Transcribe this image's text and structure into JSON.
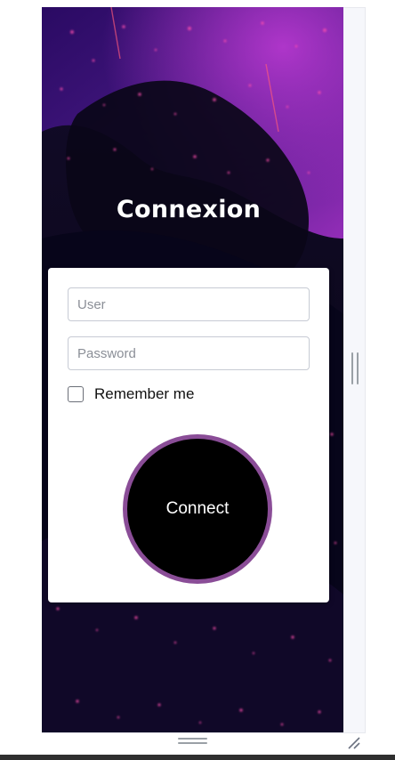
{
  "page": {
    "title": "Connexion"
  },
  "form": {
    "user_placeholder": "User",
    "password_placeholder": "Password",
    "remember_label": "Remember me",
    "remember_checked": false,
    "connect_label": "Connect"
  },
  "colors": {
    "accent_ring": "#8a4d97",
    "button_bg": "#000000",
    "card_bg": "#ffffff"
  },
  "icons": {
    "resize_grip": "resize-grip-icon",
    "scroll_handle": "scroll-handle-icon"
  }
}
